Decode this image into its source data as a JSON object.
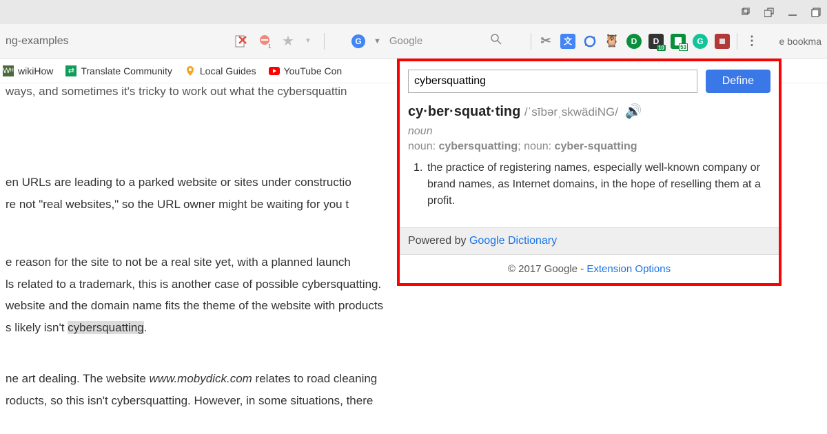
{
  "url_fragment": "ng-examples",
  "search_placeholder": "Google",
  "bookmarks": {
    "wikihow": "wikiHow",
    "translate": "Translate Community",
    "local_guides": "Local Guides",
    "youtube": "YouTube Con"
  },
  "bookmark_hint": "e bookma",
  "content": {
    "line1": "ways, and sometimes it's tricky to work out what the cybersquattin",
    "line2": "en URLs are leading to a parked website or sites under constructio",
    "line3": "re not \"real websites,\" so the URL owner might be waiting for you t",
    "line4": "e reason for the site to not be a real site yet, with a planned launch",
    "line5": "ls related to a trademark, this is another case of possible cybersquatting.",
    "line6": "website and the domain name fits the theme of the website with products",
    "line7_pre": "s likely isn't ",
    "line7_hl": "cybersquatting",
    "line7_post": ".",
    "line8_pre": "ne art dealing. The website ",
    "line8_it": "www.mobydick.com",
    "line8_post": " relates to road cleaning",
    "line9": "roducts, so this isn't cybersquatting. However, in some situations, there"
  },
  "dictionary": {
    "input_value": "cybersquatting",
    "define_label": "Define",
    "headword": "cy·ber·squat·ting",
    "pronunciation": "/ˈsībərˌskwädiNG/",
    "part_of_speech": "noun",
    "forms": "noun: cybersquatting; noun: cyber-squatting",
    "definition": "the practice of registering names, especially well-known company or brand names, as Internet domains, in the hope of reselling them at a profit.",
    "powered_prefix": "Powered by ",
    "powered_link": "Google Dictionary",
    "copyright": "© 2017 Google - ",
    "options_link": "Extension Options"
  },
  "ext_badges": {
    "d": "10",
    "clip": "53"
  }
}
